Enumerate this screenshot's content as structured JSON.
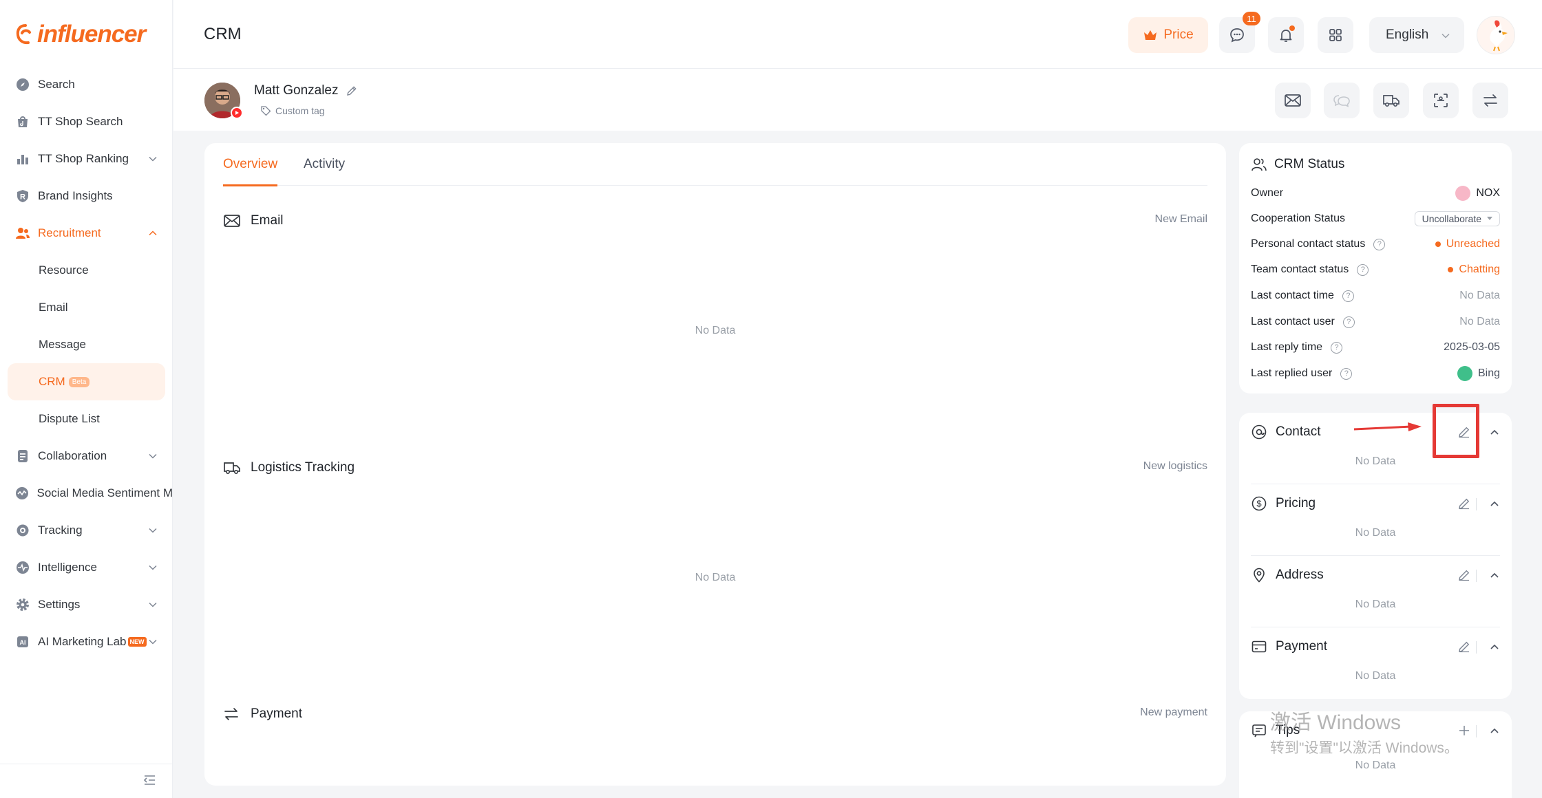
{
  "brand": {
    "logo_text": "influencer",
    "accent": "#f56a1f"
  },
  "sidebar": {
    "items": [
      {
        "label": "Search",
        "icon": "compass-icon"
      },
      {
        "label": "TT Shop Search",
        "icon": "tiktok-bag-icon"
      },
      {
        "label": "TT Shop Ranking",
        "icon": "bar-chart-icon",
        "expandable": true
      },
      {
        "label": "Brand Insights",
        "icon": "r-shield-icon"
      },
      {
        "label": "Recruitment",
        "icon": "users-icon",
        "expandable": true,
        "expanded": true
      },
      {
        "label": "Resource"
      },
      {
        "label": "Email"
      },
      {
        "label": "Message"
      },
      {
        "label": "CRM",
        "badge": "Beta",
        "selected": true
      },
      {
        "label": "Dispute List"
      },
      {
        "label": "Collaboration",
        "icon": "document-icon",
        "expandable": true
      },
      {
        "label": "Social Media Sentiment M",
        "icon": "wave-icon"
      },
      {
        "label": "Tracking",
        "icon": "target-icon",
        "expandable": true
      },
      {
        "label": "Intelligence",
        "icon": "pulse-icon",
        "expandable": true
      },
      {
        "label": "Settings",
        "icon": "gear-icon",
        "expandable": true
      },
      {
        "label": "AI Marketing Lab",
        "icon": "ai-chip-icon",
        "badge": "NEW",
        "expandable": true
      }
    ]
  },
  "header": {
    "title": "CRM",
    "price_label": "Price",
    "message_count": "11",
    "language": "English"
  },
  "profile": {
    "name": "Matt Gonzalez",
    "custom_tag": "Custom tag",
    "platform": "youtube"
  },
  "main": {
    "tabs": [
      {
        "label": "Overview",
        "active": true
      },
      {
        "label": "Activity"
      }
    ],
    "sections": [
      {
        "title": "Email",
        "action": "New Email",
        "empty": "No Data"
      },
      {
        "title": "Logistics Tracking",
        "action": "New logistics",
        "empty": "No Data"
      },
      {
        "title": "Payment",
        "action": "New payment"
      }
    ]
  },
  "crm_status": {
    "title": "CRM Status",
    "rows": [
      {
        "label": "Owner",
        "value": "NOX"
      },
      {
        "label": "Cooperation Status",
        "value": "Uncollaborate"
      },
      {
        "label": "Personal contact status",
        "value": "Unreached"
      },
      {
        "label": "Team contact status",
        "value": "Chatting"
      },
      {
        "label": "Last contact time",
        "value": "No Data"
      },
      {
        "label": "Last contact user",
        "value": "No Data"
      },
      {
        "label": "Last reply time",
        "value": "2025-03-05"
      },
      {
        "label": "Last replied user",
        "value": "Bing"
      }
    ]
  },
  "info_sections": [
    {
      "title": "Contact",
      "empty": "No Data"
    },
    {
      "title": "Pricing",
      "empty": "No Data"
    },
    {
      "title": "Address",
      "empty": "No Data"
    },
    {
      "title": "Payment",
      "empty": "No Data"
    }
  ],
  "tips": {
    "title": "Tips",
    "empty": "No Data"
  },
  "watermark": {
    "line1": "激活 Windows",
    "line2": "转到\"设置\"以激活 Windows。"
  }
}
